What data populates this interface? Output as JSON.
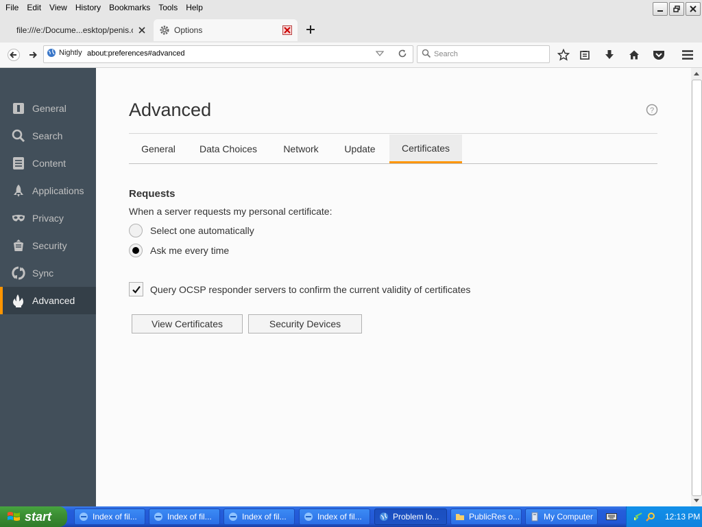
{
  "menu": [
    "File",
    "Edit",
    "View",
    "History",
    "Bookmarks",
    "Tools",
    "Help"
  ],
  "tabs": {
    "inactive_label": "file:///e:/Docume...esktop/penis.crt",
    "active_label": "Options"
  },
  "navbar": {
    "identity_label": "Nightly",
    "url": "about:preferences#advanced",
    "search_placeholder": "Search"
  },
  "sidebar": {
    "items": [
      {
        "label": "General",
        "icon": "general-icon"
      },
      {
        "label": "Search",
        "icon": "search-icon"
      },
      {
        "label": "Content",
        "icon": "content-icon"
      },
      {
        "label": "Applications",
        "icon": "applications-icon"
      },
      {
        "label": "Privacy",
        "icon": "privacy-mask-icon"
      },
      {
        "label": "Security",
        "icon": "security-icon"
      },
      {
        "label": "Sync",
        "icon": "sync-icon"
      },
      {
        "label": "Advanced",
        "icon": "advanced-icon"
      }
    ],
    "active": "Advanced"
  },
  "content": {
    "title": "Advanced",
    "subtabs": [
      "General",
      "Data Choices",
      "Network",
      "Update",
      "Certificates"
    ],
    "active_subtab": "Certificates",
    "requests_title": "Requests",
    "requests_desc": "When a server requests my personal certificate:",
    "radio_auto": "Select one automatically",
    "radio_ask": "Ask me every time",
    "radio_selected": "ask",
    "ocsp_label": "Query OCSP responder servers to confirm the current validity of certificates",
    "ocsp_checked": true,
    "view_certificates": "View Certificates",
    "security_devices": "Security Devices"
  },
  "taskbar": {
    "start_label": "start",
    "tasks": [
      {
        "label": "Index of fil..."
      },
      {
        "label": "Index of fil..."
      },
      {
        "label": "Index of fil..."
      },
      {
        "label": "Index of fil..."
      },
      {
        "label": "Problem lo..."
      },
      {
        "label": "PublicRes o..."
      },
      {
        "label": "My Computer"
      }
    ],
    "clock": "12:13 PM"
  },
  "colors": {
    "accent": "#ff9500",
    "sidebar_bg": "#424f5a",
    "taskbar_blue": "#245edb",
    "start_green": "#3c8f34"
  }
}
